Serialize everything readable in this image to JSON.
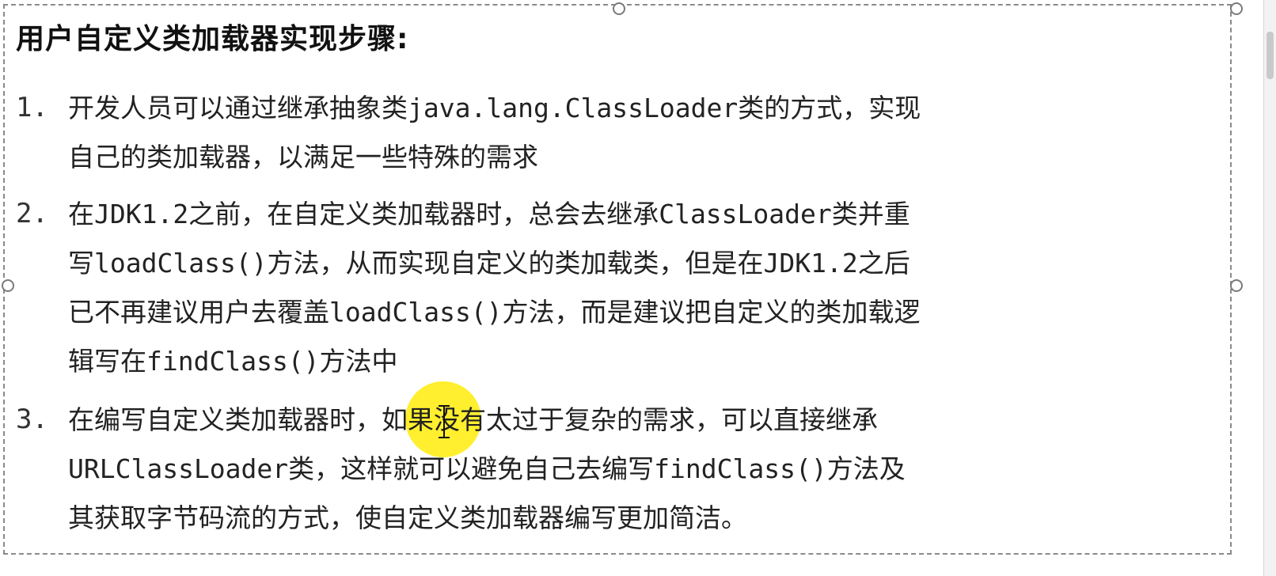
{
  "slide": {
    "title": "用户自定义类加载器实现步骤:",
    "items": [
      {
        "number": "1.",
        "lines": [
          "开发人员可以通过继承抽象类java.lang.ClassLoader类的方式，实现",
          "自己的类加载器，以满足一些特殊的需求"
        ]
      },
      {
        "number": "2.",
        "lines": [
          "在JDK1.2之前，在自定义类加载器时，总会去继承ClassLoader类并重",
          "写loadClass()方法，从而实现自定义的类加载类，但是在JDK1.2之后",
          "已不再建议用户去覆盖loadClass()方法，而是建议把自定义的类加载逻",
          "辑写在findClass()方法中"
        ]
      },
      {
        "number": "3.",
        "lines": [
          "在编写自定义类加载器时，如果没有太过于复杂的需求，可以直接继承",
          "URLClassLoader类，这样就可以避免自己去编写findClass()方法及",
          "其获取字节码流的方式，使自定义类加载器编写更加简洁。"
        ]
      }
    ]
  },
  "colors": {
    "cursor_highlight": "#ffec00",
    "text": "#222222",
    "frame": "#8a8a8a"
  },
  "icons": {
    "text_cursor": "i-beam-cursor-icon"
  }
}
